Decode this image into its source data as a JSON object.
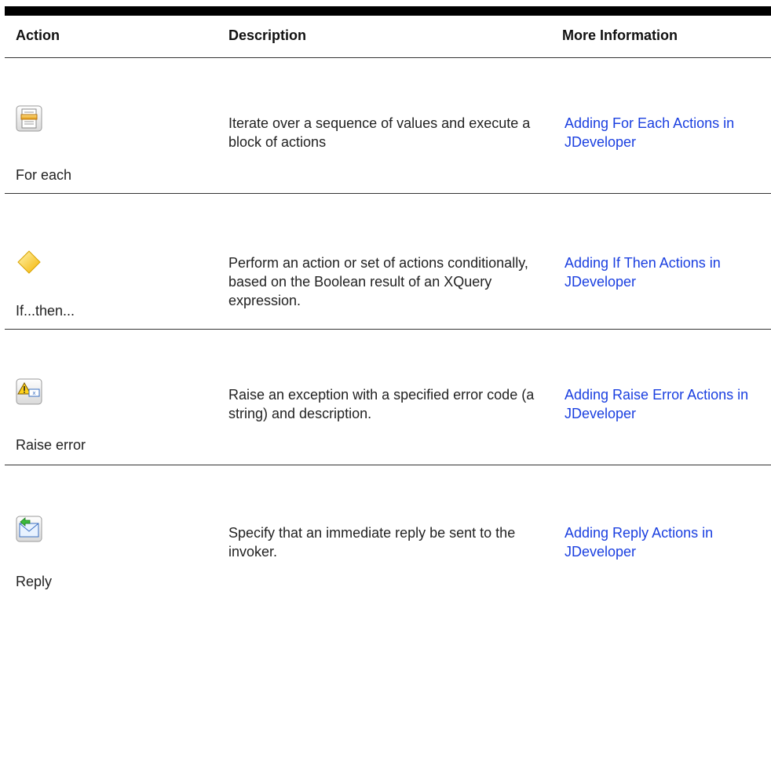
{
  "header": {
    "action": "Action",
    "description": "Description",
    "more_info": "More Information"
  },
  "rows": [
    {
      "icon": "for-each-icon",
      "label": "For each",
      "description": "Iterate over a sequence of values and execute a block of actions",
      "link": "Adding For Each Actions in JDeveloper"
    },
    {
      "icon": "if-then-diamond-icon",
      "label": "If...then...",
      "description": "Perform an action or set of actions conditionally, based on the Boolean result of an XQuery expression.",
      "link": "Adding If Then Actions in JDeveloper"
    },
    {
      "icon": "raise-error-icon",
      "label": "Raise error",
      "description": "Raise an exception with a specified error code (a string) and description.",
      "link": "Adding Raise Error Actions in JDeveloper"
    },
    {
      "icon": "reply-icon",
      "label": "Reply",
      "description": "Specify that an immediate reply be sent to the invoker.",
      "link": "Adding Reply Actions in JDeveloper"
    }
  ],
  "colors": {
    "link": "#1a3fe0",
    "text": "#222222",
    "rule": "#000000"
  }
}
